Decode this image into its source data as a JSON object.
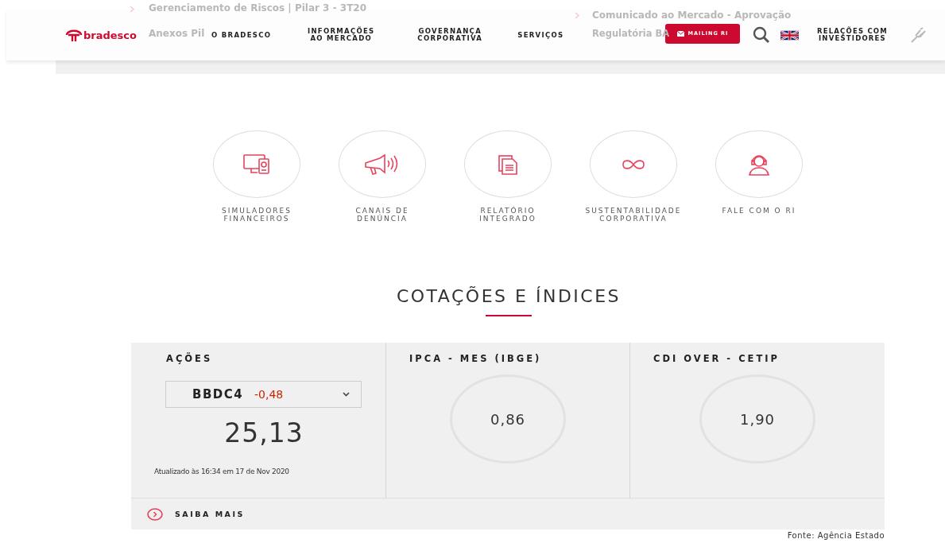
{
  "backdrop_links": [
    {
      "text": "Gerenciamento de Riscos | Pilar 3 - 3T20"
    },
    {
      "text": "Anexos Pil"
    },
    {
      "text": "Comunicado ao Mercado - Aprovação"
    },
    {
      "text": "Regulatória BA"
    }
  ],
  "header": {
    "logo": "bradesco",
    "nav": [
      "O BRADESCO",
      "INFORMAÇÕES AO MERCADO",
      "GOVERNANÇA CORPORATIVA",
      "SERVIÇOS"
    ],
    "mailing_button": "MAILING RI",
    "investors": "RELAÇÕES COM INVESTIDORES"
  },
  "shortcuts": [
    {
      "kind": "simulator",
      "label": "SIMULADORES FINANCEIROS"
    },
    {
      "kind": "megaphone",
      "label": "CANAIS DE DENÚNCIA"
    },
    {
      "kind": "document",
      "label": "RELATÓRIO INTEGRADO"
    },
    {
      "kind": "infinity",
      "label": "SUSTENTABILIDADE CORPORATIVA"
    },
    {
      "kind": "headset",
      "label": "FALE COM O RI"
    }
  ],
  "quotes": {
    "title": "COTAÇÕES E ÍNDICES",
    "stock": {
      "label": "AÇÕES",
      "ticker": "BBDC4",
      "change": "-0,48",
      "price": "25,13",
      "updated": "Atualizado às 16:34 em 17 de Nov 2020"
    },
    "indices": [
      {
        "label": "IPCA - MES (IBGE)",
        "value": "0,86"
      },
      {
        "label": "CDI OVER - CETIP",
        "value": "1,90"
      }
    ],
    "more": "SAIBA MAIS",
    "source": "Fonte: Agência Estado"
  }
}
